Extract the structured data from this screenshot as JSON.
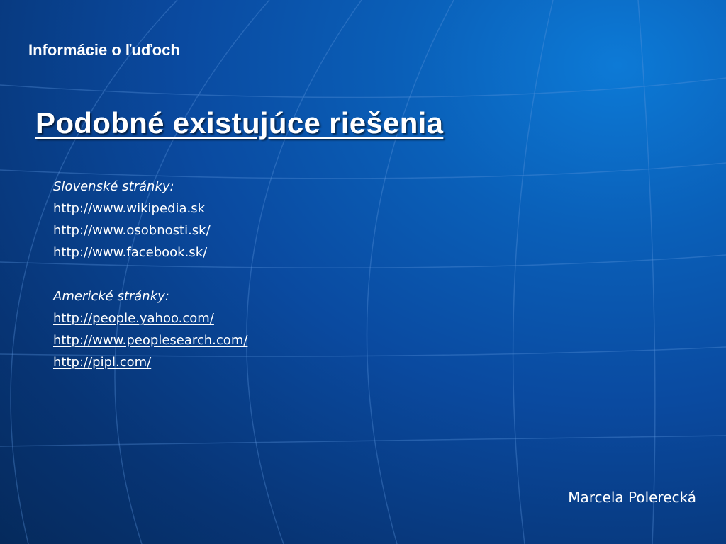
{
  "header": {
    "text": "Informácie o ľuďoch"
  },
  "title": "Podobné existujúce riešenia",
  "sections": [
    {
      "heading": "Slovenské stránky:",
      "links": [
        "http://www.wikipedia.sk",
        "http://www.osobnosti.sk/",
        "http://www.facebook.sk/"
      ]
    },
    {
      "heading": "Americké  stránky:",
      "links": [
        "http://people.yahoo.com/",
        "http://www.peoplesearch.com/",
        "http://pipl.com/"
      ]
    }
  ],
  "footer": {
    "author": "Marcela Polerecká"
  },
  "colors": {
    "background_light": "#0d7ad6",
    "background_dark": "#052a5c",
    "text": "#ffffff",
    "globe_lines": "#4a86d4"
  }
}
